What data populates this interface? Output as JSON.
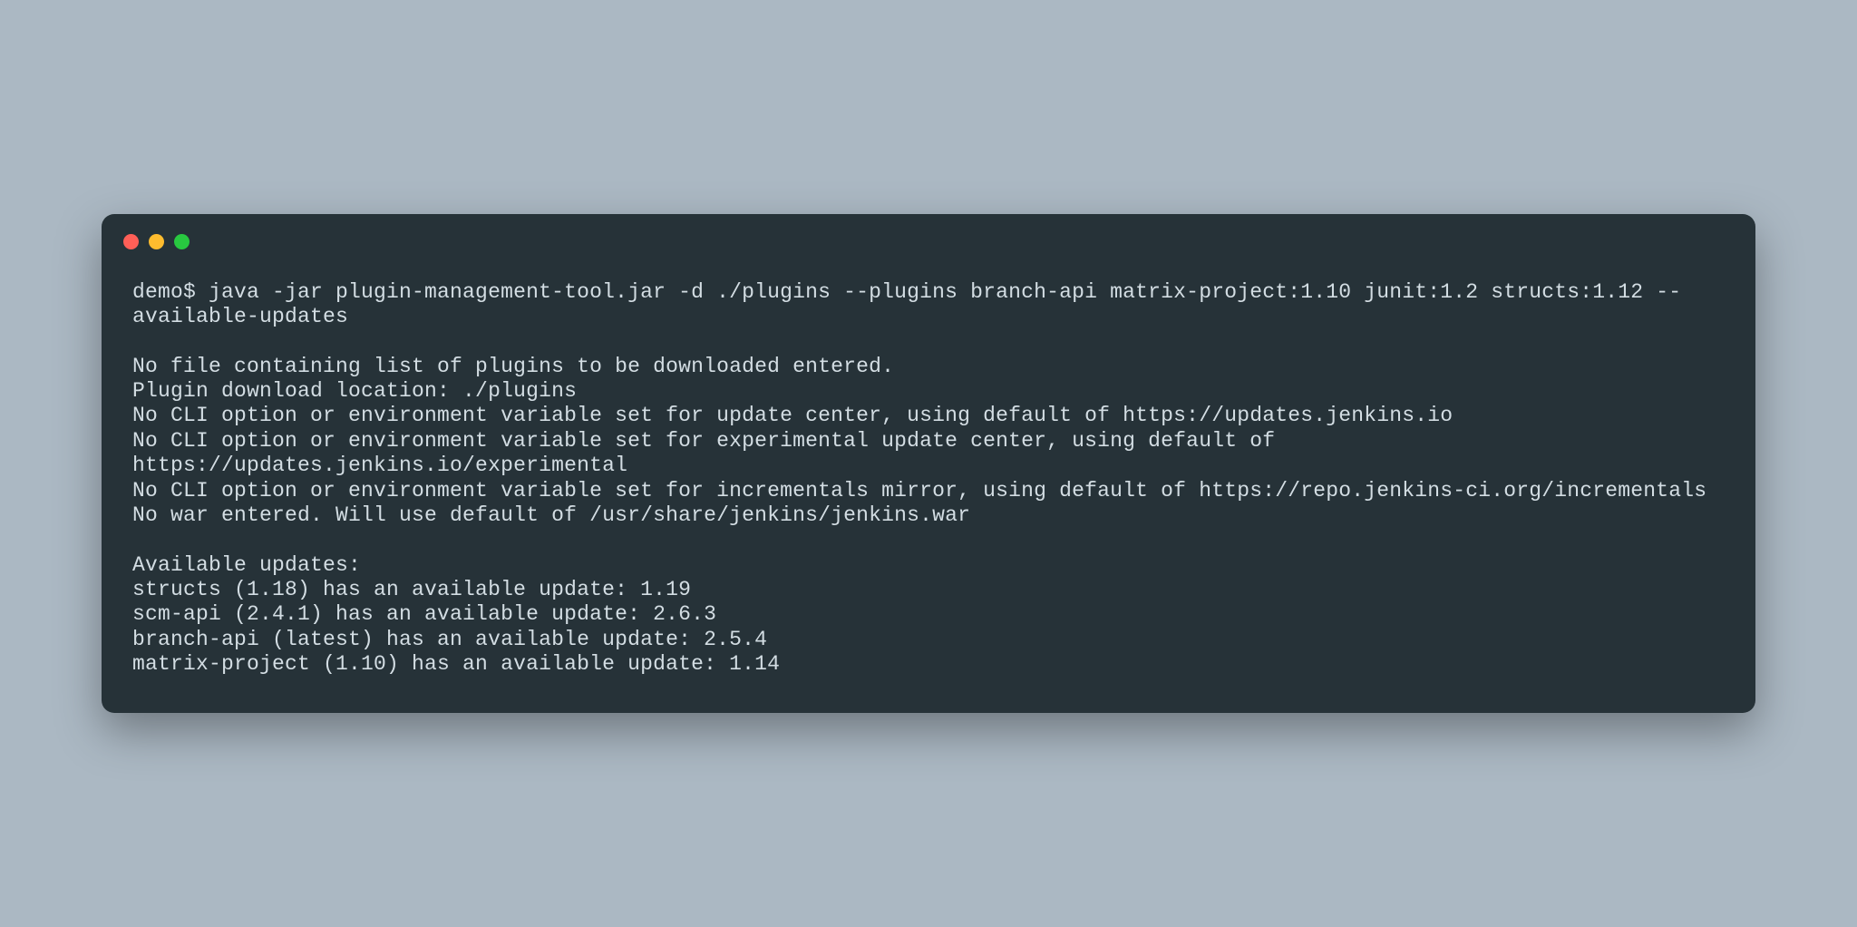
{
  "terminal": {
    "prompt_line": "demo$ java -jar plugin-management-tool.jar -d ./plugins --plugins branch-api matrix-project:1.10 junit:1.2 structs:1.12 --available-updates",
    "output": "No file containing list of plugins to be downloaded entered.\nPlugin download location: ./plugins\nNo CLI option or environment variable set for update center, using default of https://updates.jenkins.io\nNo CLI option or environment variable set for experimental update center, using default of https://updates.jenkins.io/experimental\nNo CLI option or environment variable set for incrementals mirror, using default of https://repo.jenkins-ci.org/incrementals\nNo war entered. Will use default of /usr/share/jenkins/jenkins.war\n\nAvailable updates:\nstructs (1.18) has an available update: 1.19\nscm-api (2.4.1) has an available update: 2.6.3\nbranch-api (latest) has an available update: 2.5.4\nmatrix-project (1.10) has an available update: 1.14"
  }
}
